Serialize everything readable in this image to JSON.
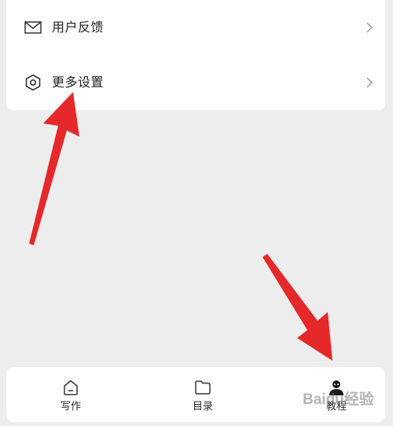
{
  "menu": {
    "items": [
      {
        "label": "用户反馈",
        "icon": "mail-icon",
        "chevron": "chevron-right-icon"
      },
      {
        "label": "更多设置",
        "icon": "hexagon-settings-icon",
        "chevron": "chevron-right-icon"
      }
    ]
  },
  "tabbar": {
    "tabs": [
      {
        "label": "写作",
        "icon": "home-icon"
      },
      {
        "label": "目录",
        "icon": "folder-icon"
      },
      {
        "label": "教程",
        "icon": "user-avatar-icon"
      }
    ]
  },
  "watermark": {
    "text": "Baidu经验"
  },
  "colors": {
    "background": "#ededed",
    "card": "#ffffff",
    "arrow": "#e5282a",
    "text": "#1f1f1f",
    "chevron": "#9a9a9a"
  }
}
